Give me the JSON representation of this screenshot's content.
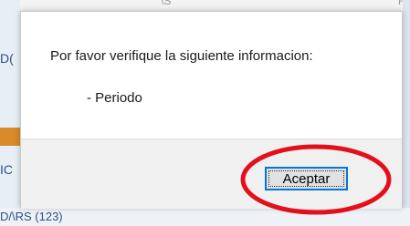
{
  "background": {
    "top_fragments": [
      "||",
      "\\S",
      "R"
    ],
    "left_fragments": [
      "D(",
      "IC"
    ],
    "bottom_text": "D/\\RS (123)"
  },
  "dialog": {
    "message": "Por favor verifique la siguiente informacion:",
    "items": [
      "- Periodo"
    ],
    "ok_label": "Aceptar"
  },
  "colors": {
    "button_focus_border": "#0078d7",
    "annotation_ellipse": "#e3101c",
    "background_orange": "#d98a2b"
  }
}
